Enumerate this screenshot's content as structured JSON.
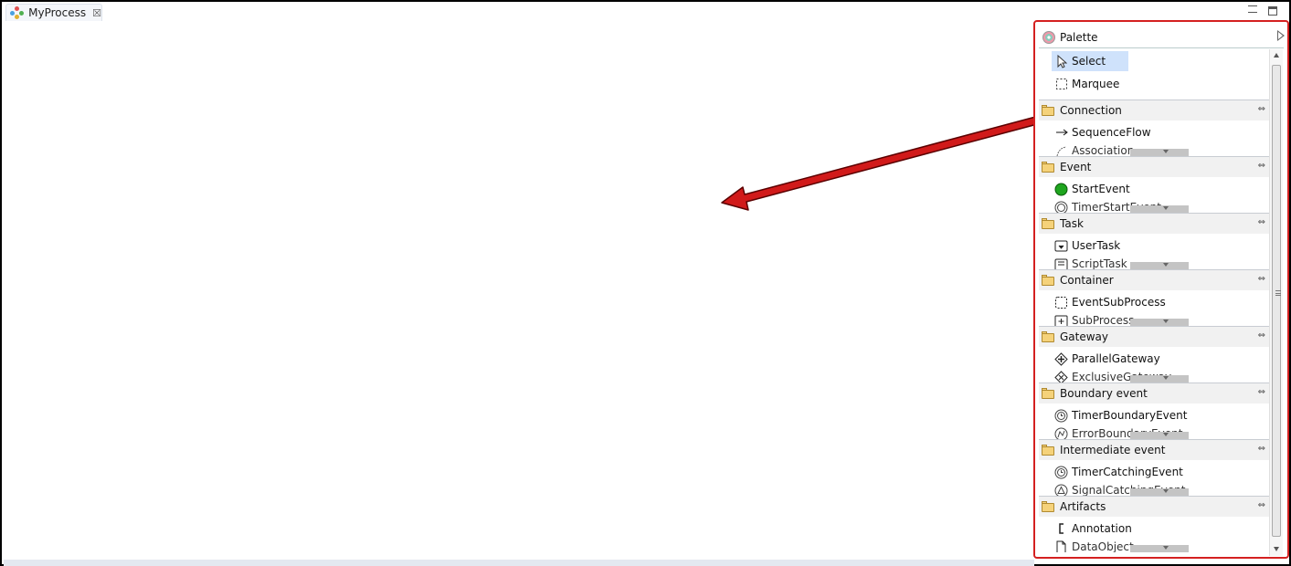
{
  "editor": {
    "tab_title": "MyProcess",
    "tab_close": "☒"
  },
  "palette": {
    "title": "Palette",
    "tools": [
      {
        "label": "Select",
        "icon": "pointer-icon",
        "selected": true
      },
      {
        "label": "Marquee",
        "icon": "marquee-icon",
        "selected": false
      }
    ],
    "drawers": [
      {
        "label": "Connection",
        "first_item": "SequenceFlow",
        "first_icon": "arrow-right-icon",
        "second_item": "Association",
        "second_icon": "association-icon"
      },
      {
        "label": "Event",
        "first_item": "StartEvent",
        "first_icon": "start-event-icon",
        "second_item": "TimerStartEvent",
        "second_icon": "timer-icon"
      },
      {
        "label": "Task",
        "first_item": "UserTask",
        "first_icon": "user-task-icon",
        "second_item": "ScriptTask",
        "second_icon": "script-task-icon"
      },
      {
        "label": "Container",
        "first_item": "EventSubProcess",
        "first_icon": "event-subprocess-icon",
        "second_item": "SubProcess",
        "second_icon": "subprocess-icon"
      },
      {
        "label": "Gateway",
        "first_item": "ParallelGateway",
        "first_icon": "parallel-gateway-icon",
        "second_item": "ExclusiveGateway",
        "second_icon": "exclusive-gateway-icon"
      },
      {
        "label": "Boundary event",
        "first_item": "TimerBoundaryEvent",
        "first_icon": "timer-icon",
        "second_item": "ErrorBoundaryEvent",
        "second_icon": "error-icon"
      },
      {
        "label": "Intermediate event",
        "first_item": "TimerCatchingEvent",
        "first_icon": "timer-icon",
        "second_item": "SignalCatchingEvent",
        "second_icon": "signal-icon"
      },
      {
        "label": "Artifacts",
        "first_item": "Annotation",
        "first_icon": "annotation-icon",
        "second_item": "DataObject",
        "second_icon": "data-object-icon"
      }
    ],
    "pin_symbol": "⇔"
  },
  "colors": {
    "highlight_border": "#d42020",
    "arrow_fill": "#d11a1a",
    "selected_tool_bg": "#cfe2fb"
  }
}
